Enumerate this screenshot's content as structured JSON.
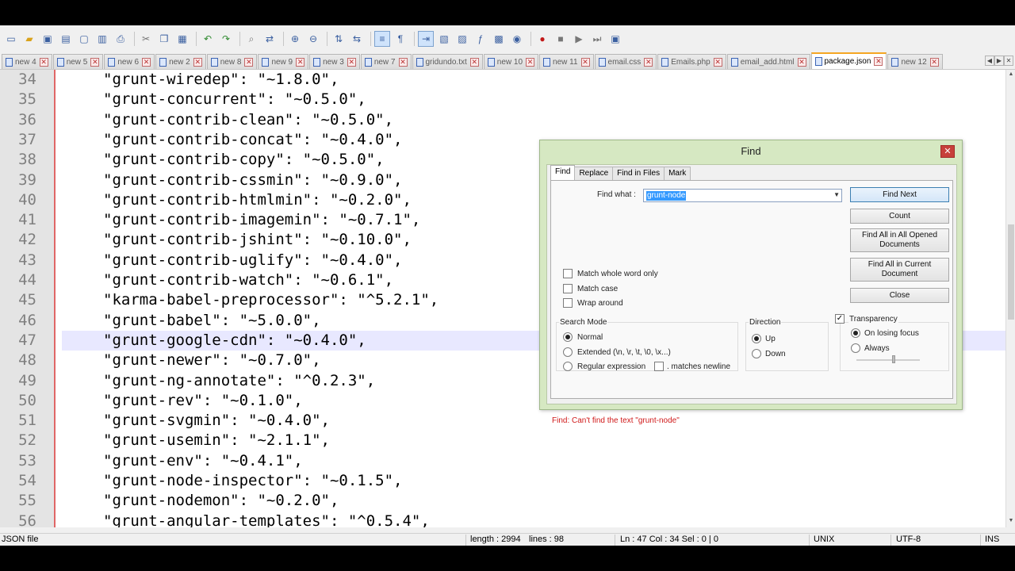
{
  "tabs": [
    "new 4",
    "new 5",
    "new 6",
    "new 2",
    "new 8",
    "new 9",
    "new 3",
    "new 7",
    "gridundo.txt",
    "new 10",
    "new 11",
    "email.css",
    "Emails.php",
    "email_add.html",
    "package.json",
    "new 12"
  ],
  "active_tab_index": 14,
  "editor": {
    "lines": [
      {
        "n": "34",
        "text": "\"grunt-wiredep\": \"~1.8.0\","
      },
      {
        "n": "35",
        "text": "\"grunt-concurrent\": \"~0.5.0\","
      },
      {
        "n": "36",
        "text": "\"grunt-contrib-clean\": \"~0.5.0\","
      },
      {
        "n": "37",
        "text": "\"grunt-contrib-concat\": \"~0.4.0\","
      },
      {
        "n": "38",
        "text": "\"grunt-contrib-copy\": \"~0.5.0\","
      },
      {
        "n": "39",
        "text": "\"grunt-contrib-cssmin\": \"~0.9.0\","
      },
      {
        "n": "40",
        "text": "\"grunt-contrib-htmlmin\": \"~0.2.0\","
      },
      {
        "n": "41",
        "text": "\"grunt-contrib-imagemin\": \"~0.7.1\","
      },
      {
        "n": "42",
        "text": "\"grunt-contrib-jshint\": \"~0.10.0\","
      },
      {
        "n": "43",
        "text": "\"grunt-contrib-uglify\": \"~0.4.0\","
      },
      {
        "n": "44",
        "text": "\"grunt-contrib-watch\": \"~0.6.1\","
      },
      {
        "n": "45",
        "text": "\"karma-babel-preprocessor\": \"^5.2.1\","
      },
      {
        "n": "46",
        "text": "\"grunt-babel\": \"~5.0.0\","
      },
      {
        "n": "47",
        "text": "\"grunt-google-cdn\": \"~0.4.0\","
      },
      {
        "n": "48",
        "text": "\"grunt-newer\": \"~0.7.0\","
      },
      {
        "n": "49",
        "text": "\"grunt-ng-annotate\": \"^0.2.3\","
      },
      {
        "n": "50",
        "text": "\"grunt-rev\": \"~0.1.0\","
      },
      {
        "n": "51",
        "text": "\"grunt-svgmin\": \"~0.4.0\","
      },
      {
        "n": "52",
        "text": "\"grunt-usemin\": \"~2.1.1\","
      },
      {
        "n": "53",
        "text": "\"grunt-env\": \"~0.4.1\","
      },
      {
        "n": "54",
        "text": "\"grunt-node-inspector\": \"~0.1.5\","
      },
      {
        "n": "55",
        "text": "\"grunt-nodemon\": \"~0.2.0\","
      },
      {
        "n": "56",
        "text": "\"grunt-angular-templates\": \"^0.5.4\","
      }
    ],
    "current_line": "47"
  },
  "status": {
    "file_type": "JSON file",
    "length": "length : 2994",
    "lines": "lines : 98",
    "position": "Ln : 47    Col : 34    Sel : 0 | 0",
    "eol": "UNIX",
    "encoding": "UTF-8",
    "mode": "INS"
  },
  "find_dialog": {
    "title": "Find",
    "tabs": [
      "Find",
      "Replace",
      "Find in Files",
      "Mark"
    ],
    "find_what_label": "Find what :",
    "find_what_value": "grunt-node",
    "buttons": {
      "find_next": "Find Next",
      "count": "Count",
      "find_all_opened_1": "Find All in All Opened",
      "find_all_opened_2": "Documents",
      "find_all_current_1": "Find All in Current",
      "find_all_current_2": "Document",
      "close": "Close"
    },
    "options": {
      "match_whole_word": "Match whole word only",
      "match_case": "Match case",
      "wrap_around": "Wrap around"
    },
    "search_mode": {
      "title": "Search Mode",
      "normal": "Normal",
      "extended": "Extended (\\n, \\r, \\t, \\0, \\x...)",
      "regex": "Regular expression",
      "matches_newline": ". matches newline"
    },
    "direction": {
      "title": "Direction",
      "up": "Up",
      "down": "Down"
    },
    "transparency": {
      "title": "Transparency",
      "on_losing_focus": "On losing focus",
      "always": "Always"
    },
    "message": "Find: Can't find the text \"grunt-node\""
  },
  "colors": {
    "gutter_border": "#e06666",
    "current_line": "#e8e8ff",
    "dialog_frame": "#d6e8c2",
    "error_text": "#d01a1a"
  }
}
